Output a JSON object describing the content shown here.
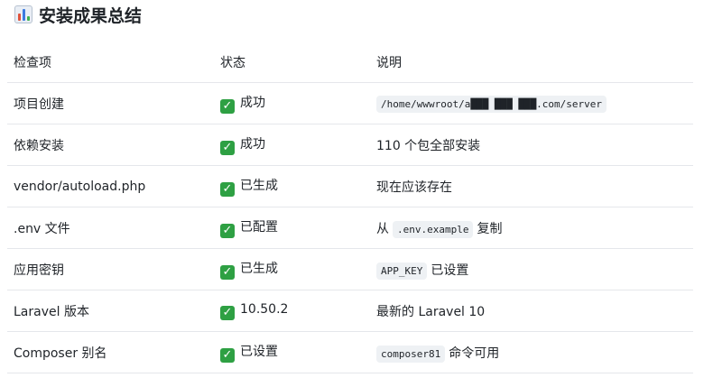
{
  "title": "安装成果总结",
  "title_icon": "bar-chart-icon",
  "table": {
    "headers": [
      "检查项",
      "状态",
      "说明"
    ],
    "rows": [
      {
        "item": "项目创建",
        "status": "成功",
        "desc_prefix": "",
        "desc_code": "/home/wwwroot/a███ ███ ███.com/server",
        "desc_suffix": ""
      },
      {
        "item": "依赖安装",
        "status": "成功",
        "desc_prefix": "110 个包全部安装",
        "desc_code": "",
        "desc_suffix": ""
      },
      {
        "item": "vendor/autoload.php",
        "status": "已生成",
        "desc_prefix": "现在应该存在",
        "desc_code": "",
        "desc_suffix": ""
      },
      {
        "item": ".env 文件",
        "status": "已配置",
        "desc_prefix": "从",
        "desc_code": ".env.example",
        "desc_suffix": "复制"
      },
      {
        "item": "应用密钥",
        "status": "已生成",
        "desc_prefix": "",
        "desc_code": "APP_KEY",
        "desc_suffix": "已设置"
      },
      {
        "item": "Laravel 版本",
        "status": "10.50.2",
        "desc_prefix": "最新的 Laravel 10",
        "desc_code": "",
        "desc_suffix": ""
      },
      {
        "item": "Composer 别名",
        "status": "已设置",
        "desc_prefix": "",
        "desc_code": "composer81",
        "desc_suffix": "命令可用"
      }
    ]
  },
  "status_icon": "check-mark-icon",
  "status_icon_glyph": "✓",
  "colors": {
    "check": "#2ea043",
    "code_bg": "#eef1f4",
    "border": "#e5e7eb"
  }
}
